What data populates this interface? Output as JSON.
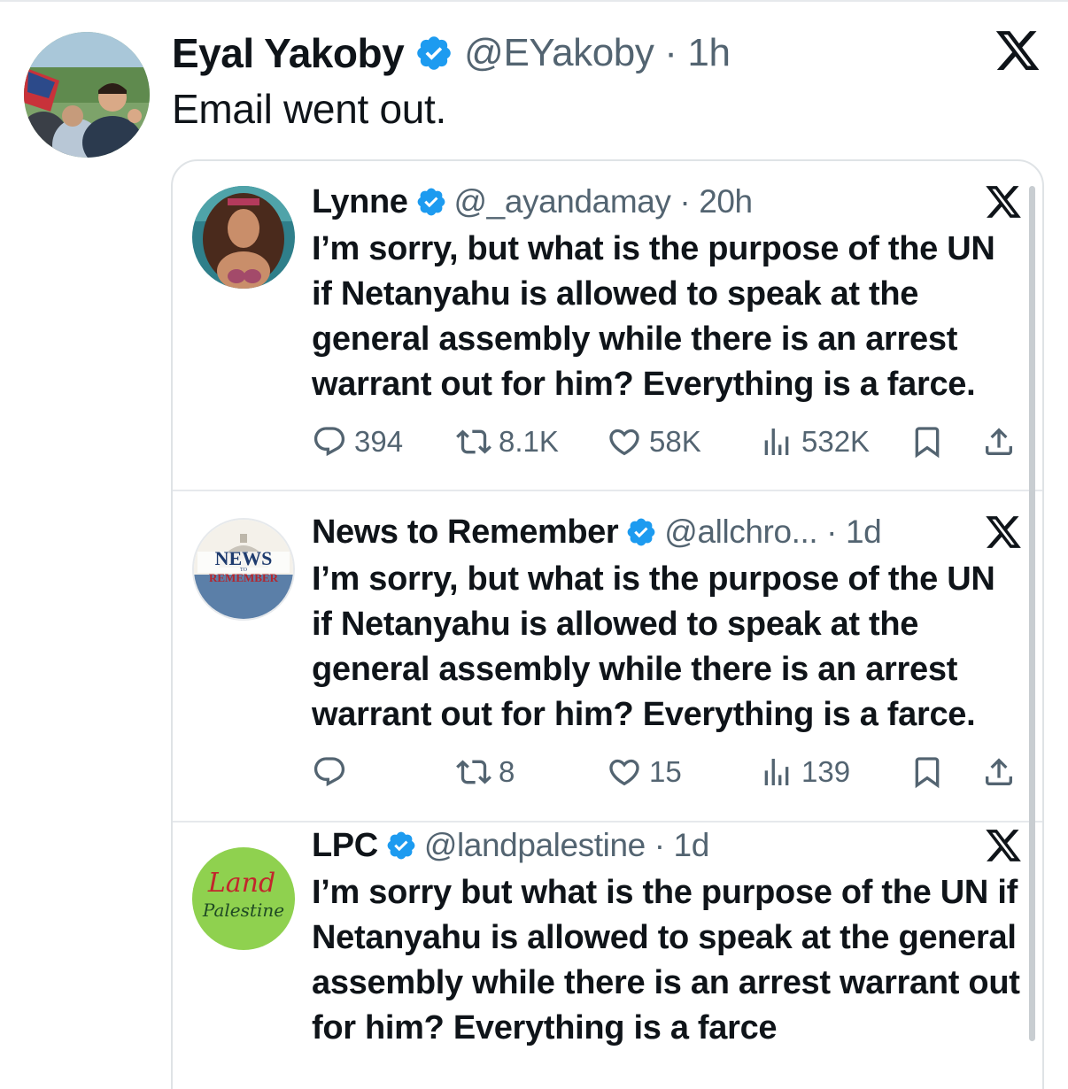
{
  "outer_tweet": {
    "name": "Eyal Yakoby",
    "handle_time": "@EYakoby · 1h",
    "text": "Email went out.",
    "verified": true
  },
  "quoted_tweets": [
    {
      "name": "Lynne",
      "handle_time": "@_ayandamay · 20h",
      "text": "I’m sorry, but what is the purpose of the UN if Netanyahu is allowed to speak at the general assembly while there is an arrest warrant out for him? Everything is a farce.",
      "replies": "394",
      "reposts": "8.1K",
      "likes": "58K",
      "views": "532K"
    },
    {
      "name": "News to Remember",
      "handle_time": "@allchro... · 1d",
      "text": "I’m sorry, but what is the purpose of the UN if Netanyahu is allowed to speak at the general assembly while there is an arrest warrant out for him? Everything is a farce.",
      "replies": "",
      "reposts": "8",
      "likes": "15",
      "views": "139",
      "avatar_logo_top": "NEWS",
      "avatar_logo_mid": "TO",
      "avatar_logo_bottom": "REMEMBER"
    },
    {
      "name": "LPC",
      "handle_time": "@landpalestine · 1d",
      "text": "I’m sorry but what is the purpose of the UN if Netanyahu is allowed to speak at the general assembly while there is an arrest warrant out for him? Everything is a farce",
      "avatar_logo_top": "Land",
      "avatar_logo_bottom": "Palestine"
    }
  ],
  "colors": {
    "text": "#0f1419",
    "secondary": "#536471",
    "verified_blue": "#1d9bf0",
    "border": "#dfe3e6"
  },
  "icons": [
    "verified-badge-icon",
    "x-logo-icon",
    "reply-icon",
    "repost-icon",
    "like-icon",
    "views-icon",
    "bookmark-icon",
    "share-icon"
  ]
}
